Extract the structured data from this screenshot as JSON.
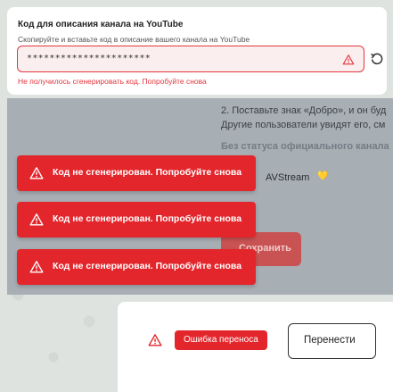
{
  "top_card": {
    "title": "Код для описания канала на YouTube",
    "subtitle": "Скопируйте и вставьте код в описание вашего канала на YouTube",
    "code_value": "**********************",
    "error_text": "Не получилось сгенерировать код. Попробуйте снова",
    "icons": {
      "warning": "warning-triangle-icon",
      "reload": "reload-icon"
    }
  },
  "middle_panel": {
    "hint_line1": "2. Поставьте знак «Добро», и он буд",
    "hint_line2": "Другие пользователи увидят его, см",
    "status": "Без статуса официального канала",
    "channel_name": "AVStream",
    "channel_badge": "💛",
    "save_label": "Сохранить"
  },
  "toasts": [
    {
      "text": "Код не сгенерирован. Попробуйте снова"
    },
    {
      "text": "Код не сгенерирован. Попробуйте снова"
    },
    {
      "text": "Код не сгенерирован. Попробуйте снова"
    }
  ],
  "bottom_card": {
    "error_badge": "Ошибка переноса",
    "transfer_button": "Перенести"
  },
  "colors": {
    "error_red": "#e3262c",
    "field_border": "#e3363d",
    "overlay": "#a7aeb4",
    "card": "#ffffff"
  }
}
